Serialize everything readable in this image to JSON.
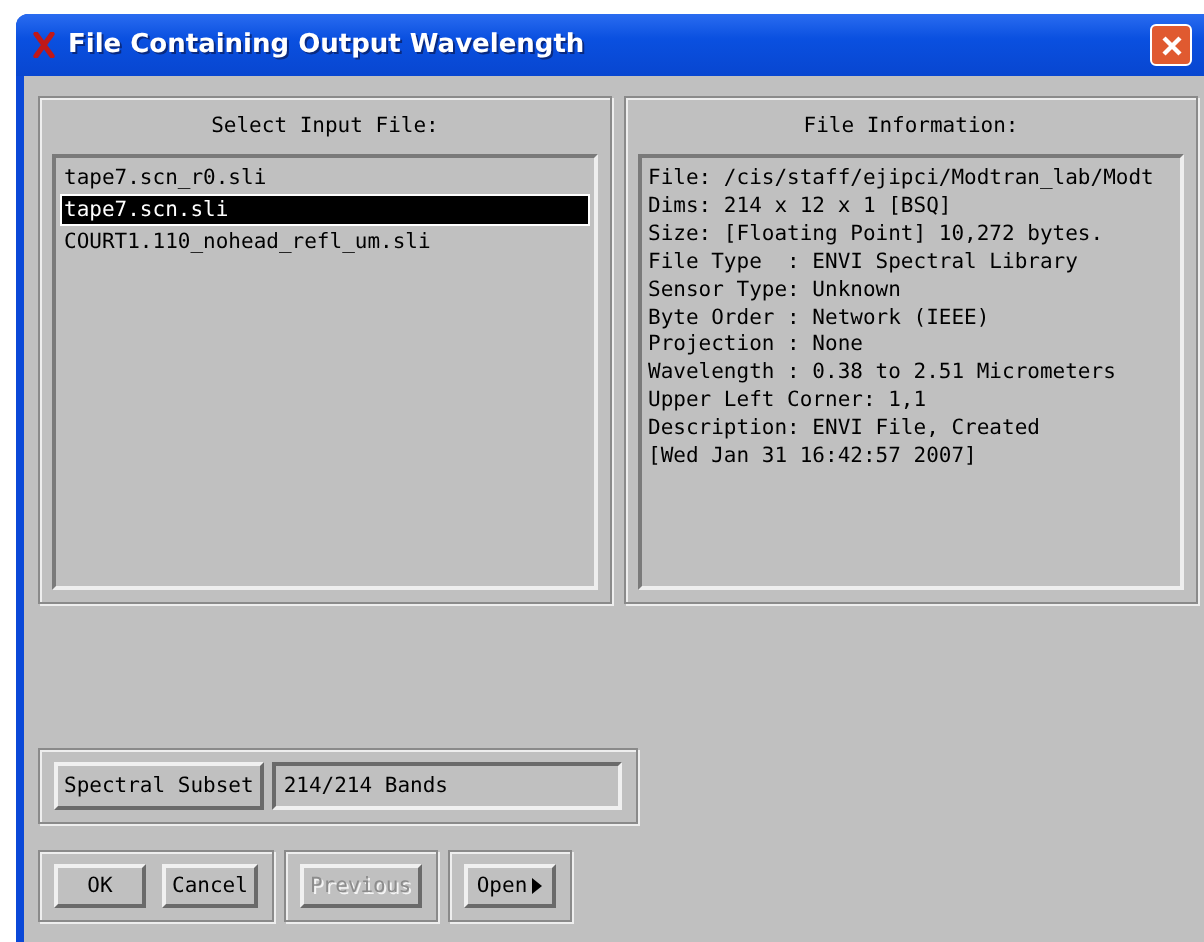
{
  "window": {
    "title": "File Containing Output Wavelength"
  },
  "input_files": {
    "heading": "Select Input File:",
    "items": [
      {
        "name": "tape7.scn_r0.sli",
        "selected": false
      },
      {
        "name": "tape7.scn.sli",
        "selected": true
      },
      {
        "name": "COURT1.110_nohead_refl_um.sli",
        "selected": false
      }
    ]
  },
  "file_information": {
    "heading": "File Information:",
    "lines": [
      "File: /cis/staff/ejipci/Modtran_lab/Modt",
      "Dims: 214 x 12 x 1 [BSQ]",
      "Size: [Floating Point] 10,272 bytes.",
      "File Type  : ENVI Spectral Library",
      "Sensor Type: Unknown",
      "Byte Order : Network (IEEE)",
      "Projection : None",
      "Wavelength : 0.38 to 2.51 Micrometers",
      "Upper Left Corner: 1,1",
      "Description: ENVI File, Created",
      "[Wed Jan 31 16:42:57 2007]"
    ]
  },
  "spectral_subset": {
    "button": "Spectral Subset",
    "value": "214/214 Bands"
  },
  "button_groups": [
    [
      {
        "label": "OK",
        "disabled": false,
        "kind": "plain"
      },
      {
        "label": "Cancel",
        "disabled": false,
        "kind": "plain"
      }
    ],
    [
      {
        "label": "Previous",
        "disabled": true,
        "kind": "plain"
      }
    ],
    [
      {
        "label": "Open",
        "disabled": false,
        "kind": "menu"
      }
    ]
  ]
}
